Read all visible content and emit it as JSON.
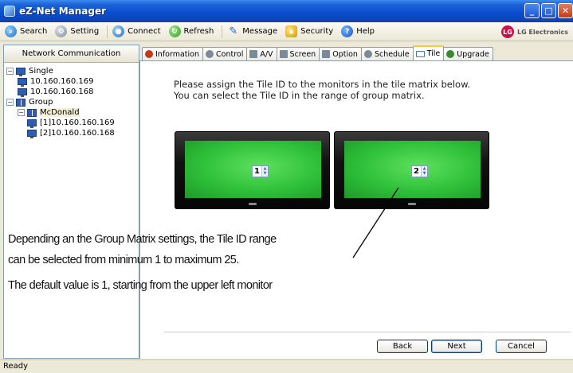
{
  "window": {
    "title": "eZ-Net Manager"
  },
  "toolbar": {
    "items": [
      {
        "label": "Search",
        "icon": "search-icon"
      },
      {
        "label": "Setting",
        "icon": "setting-icon"
      },
      {
        "label": "Connect",
        "icon": "connect-icon"
      },
      {
        "label": "Refresh",
        "icon": "refresh-icon"
      },
      {
        "label": "Message",
        "icon": "message-icon"
      },
      {
        "label": "Security",
        "icon": "security-icon"
      },
      {
        "label": "Help",
        "icon": "help-icon"
      }
    ],
    "brand": "LG Electronics"
  },
  "sidebar": {
    "header": "Network Communication",
    "tree": {
      "single": "Single",
      "single_items": [
        "10.160.160.169",
        "10.160.160.168"
      ],
      "group": "Group",
      "group_name": "McDonald",
      "group_items": [
        "[1]10.160.160.169",
        "[2]10.160.160.168"
      ]
    }
  },
  "tabs": [
    {
      "label": "Information",
      "icon": "information-icon"
    },
    {
      "label": "Control",
      "icon": "control-icon"
    },
    {
      "label": "A/V",
      "icon": "av-icon"
    },
    {
      "label": "Screen",
      "icon": "screen-icon"
    },
    {
      "label": "Option",
      "icon": "option-icon"
    },
    {
      "label": "Schedule",
      "icon": "schedule-icon"
    },
    {
      "label": "Tile",
      "icon": "tile-icon",
      "active": true
    },
    {
      "label": "Upgrade",
      "icon": "upgrade-icon"
    }
  ],
  "tile": {
    "instruction_line1": "Please assign the Tile ID to the monitors in the tile matrix below.",
    "instruction_line2": "You can select the Tile ID in the range of group matrix.",
    "monitors": [
      {
        "tile_id": "1"
      },
      {
        "tile_id": "2"
      }
    ]
  },
  "annotation": {
    "line1": "Depending an the Group Matrix settings, the Tile ID range",
    "line2": "can be selected from minimum 1 to maximum 25.",
    "line3": "The default value is 1, starting from the upper left monitor"
  },
  "buttons": {
    "back": "Back",
    "next": "Next",
    "cancel": "Cancel"
  },
  "status": "Ready",
  "colors": {
    "titlebar": "#0a4fd0",
    "screen_green": "#2fc03a",
    "tab_highlight": "#ffc73c"
  }
}
